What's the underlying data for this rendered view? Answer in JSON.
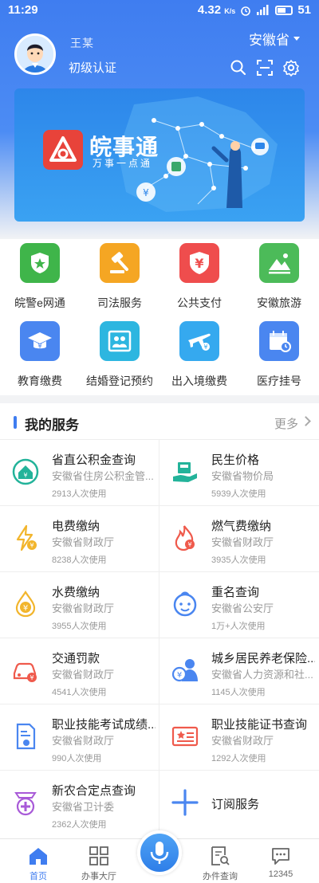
{
  "status_bar": {
    "time": "11:29",
    "speed": "4.32",
    "speed_unit": "K/s",
    "battery": "51"
  },
  "header": {
    "username": "王某",
    "certification": "初级认证",
    "region": "安徽省"
  },
  "banner": {
    "brand": "皖事通",
    "slogan": "万事一点通"
  },
  "quick_services": [
    {
      "label": "皖警e网通",
      "color": "#3fb54a",
      "icon": "police-shield-icon"
    },
    {
      "label": "司法服务",
      "color": "#f5a623",
      "icon": "gavel-icon"
    },
    {
      "label": "公共支付",
      "color": "#ef4d4d",
      "icon": "yuan-shield-icon"
    },
    {
      "label": "安徽旅游",
      "color": "#4cbb59",
      "icon": "landscape-icon"
    },
    {
      "label": "教育缴费",
      "color": "#4a86f0",
      "icon": "graduation-cap-icon"
    },
    {
      "label": "结婚登记预约",
      "color": "#2db6e0",
      "icon": "couple-icon"
    },
    {
      "label": "出入境缴费",
      "color": "#35a9ef",
      "icon": "airplane-icon"
    },
    {
      "label": "医疗挂号",
      "color": "#4a86f0",
      "icon": "calendar-clock-icon"
    }
  ],
  "my_services": {
    "title": "我的服务",
    "more": "更多",
    "items": [
      {
        "name": "省直公积金查询",
        "org": "安徽省住房公积金管...",
        "usage": "2913人次使用",
        "color": "#23b39a",
        "icon": "house-fund-icon"
      },
      {
        "name": "民生价格",
        "org": "安徽省物价局",
        "usage": "5939人次使用",
        "color": "#23b39a",
        "icon": "price-hand-icon"
      },
      {
        "name": "电费缴纳",
        "org": "安徽省财政厅",
        "usage": "8238人次使用",
        "color": "#f2b52c",
        "icon": "electric-bolt-icon"
      },
      {
        "name": "燃气费缴纳",
        "org": "安徽省财政厅",
        "usage": "3935人次使用",
        "color": "#ef5a4c",
        "icon": "gas-flame-icon"
      },
      {
        "name": "水费缴纳",
        "org": "安徽省财政厅",
        "usage": "3955人次使用",
        "color": "#f2b52c",
        "icon": "water-drop-icon"
      },
      {
        "name": "重名查询",
        "org": "安徽省公安厅",
        "usage": "1万+人次使用",
        "color": "#4a86f0",
        "icon": "baby-face-icon"
      },
      {
        "name": "交通罚款",
        "org": "安徽省财政厅",
        "usage": "4541人次使用",
        "color": "#ef5a4c",
        "icon": "car-fine-icon"
      },
      {
        "name": "城乡居民养老保险...",
        "org": "安徽省人力资源和社...",
        "usage": "1145人次使用",
        "color": "#4a86f0",
        "icon": "elder-yuan-icon"
      },
      {
        "name": "职业技能考试成绩...",
        "org": "安徽省财政厅",
        "usage": "990人次使用",
        "color": "#4a86f0",
        "icon": "document-score-icon"
      },
      {
        "name": "职业技能证书查询",
        "org": "安徽省财政厅",
        "usage": "1292人次使用",
        "color": "#ef5a4c",
        "icon": "certificate-icon"
      },
      {
        "name": "新农合定点查询",
        "org": "安徽省卫计委",
        "usage": "2362人次使用",
        "color": "#a85ad8",
        "icon": "medical-pin-icon"
      }
    ],
    "subscribe": "订阅服务"
  },
  "bottom_nav": [
    {
      "label": "首页",
      "icon": "home-icon",
      "active": true
    },
    {
      "label": "办事大厅",
      "icon": "grid-hall-icon",
      "active": false
    },
    {
      "label": "办件查询",
      "icon": "search-doc-icon",
      "active": false
    },
    {
      "label": "12345",
      "icon": "chat-bubble-icon",
      "active": false
    }
  ],
  "colors": {
    "primary": "#3f7df0",
    "header_gradient_top": "#3f7df0"
  }
}
